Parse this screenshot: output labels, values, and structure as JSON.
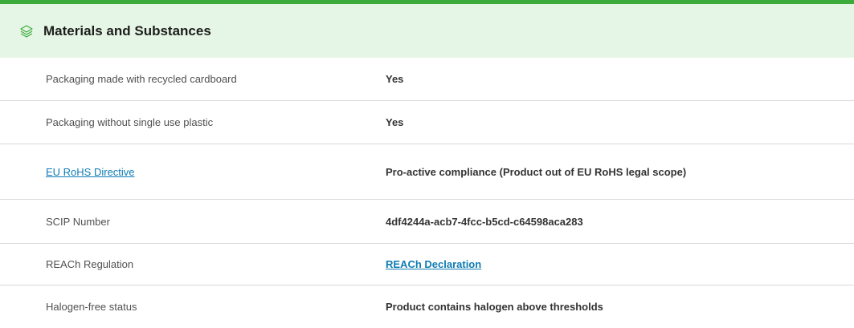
{
  "section": {
    "title": "Materials and Substances",
    "icon": "layers-icon",
    "accent_color": "#3dab3b",
    "header_bg": "#e6f6e6"
  },
  "rows": [
    {
      "label": "Packaging made with recycled cardboard",
      "value": "Yes"
    },
    {
      "label": "Packaging without single use plastic",
      "value": "Yes"
    },
    {
      "label": "EU RoHS Directive",
      "value": "Pro-active compliance (Product out of EU RoHS legal scope)"
    },
    {
      "label": "SCIP Number",
      "value": "4df4244a-acb7-4fcc-b5cd-c64598aca283"
    },
    {
      "label": "REACh Regulation",
      "value": "REACh Declaration"
    },
    {
      "label": "Halogen-free status",
      "value": "Product contains halogen above thresholds"
    }
  ]
}
